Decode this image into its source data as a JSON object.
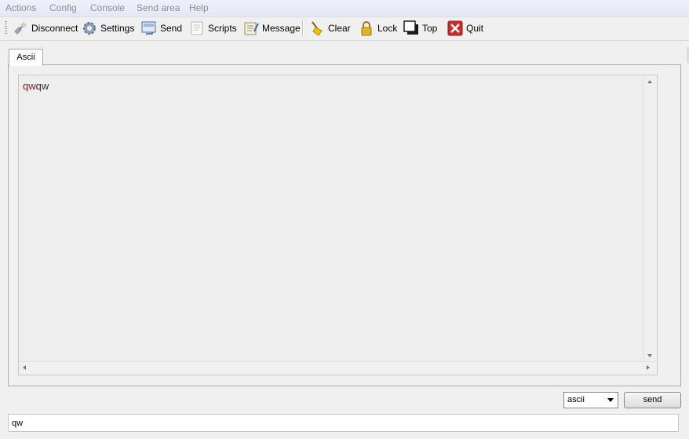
{
  "menu": {
    "items": [
      "Actions",
      "Config",
      "Console",
      "Send area",
      "Help"
    ]
  },
  "toolbar": {
    "disconnect": "Disconnect",
    "settings": "Settings",
    "send": "Send",
    "scripts": "Scripts",
    "message": "Message",
    "clear": "Clear",
    "lock": "Lock",
    "top": "Top",
    "quit": "Quit"
  },
  "tabs": [
    "Ascii"
  ],
  "console": {
    "received_text": "qw",
    "sent_text": "qw"
  },
  "send_area": {
    "format_selected": "ascii",
    "send_label": "send",
    "input_value": "qw"
  },
  "colors": {
    "received": "#8b1a1a",
    "sent": "#333333",
    "quit_icon": "#d22b2b"
  }
}
